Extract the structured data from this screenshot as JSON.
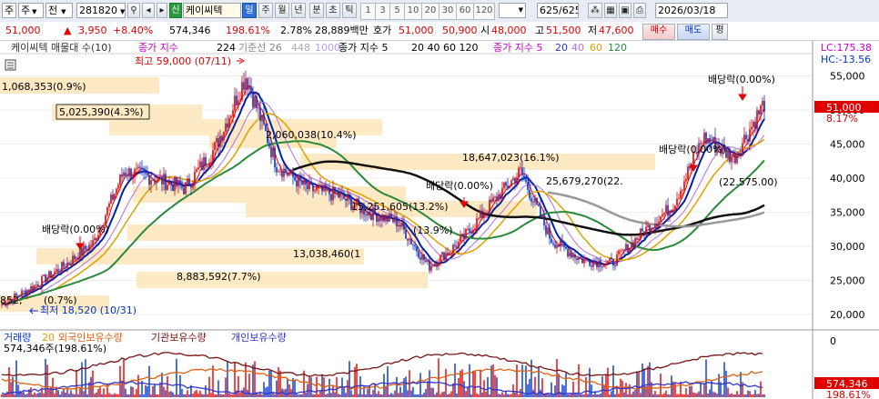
{
  "toolbar": {
    "type_select": "주",
    "price_select": "전",
    "code": "281820",
    "sin_badge": "신",
    "stock_name": "케이씨텍",
    "period_day": "일",
    "period_week": "주",
    "period_month": "월",
    "period_year": "년",
    "period_minute": "분",
    "period_second": "초",
    "period_tick": "틱",
    "intervals": [
      "1",
      "3",
      "5",
      "10",
      "20",
      "30",
      "60",
      "120"
    ],
    "count": "625/625",
    "date": "2026/03/18"
  },
  "quote": {
    "price": "51,000",
    "change_arrow": "▲",
    "change": "3,950",
    "change_pct": "+8.40%",
    "volume": "574,346",
    "volume_pct": "198.61%",
    "turnover": "2.78%",
    "amount": "28,889백만",
    "ask_label": "호가",
    "ask": "51,000",
    "bid": "50,900",
    "open_label": "시",
    "open": "48,000",
    "high_label": "고",
    "high": "51,500",
    "low_label": "저",
    "low": "47,600",
    "buy_button": "매수",
    "sell_button": "매도",
    "eval_button": "평"
  },
  "legend": {
    "main": "케이씨텍 매물대 수(10)",
    "ma_label": "종가 지수",
    "ma_224": "224",
    "ma_base": "기준선 26",
    "ma_448": "448",
    "ma_1000": "1000",
    "ma2_label": "종가 지수 5",
    "ma2_periods": "20  40  60  120",
    "ma3_label": "종가 지수 5",
    "ma3_20": "20",
    "ma3_40": "40",
    "ma3_60": "60",
    "ma3_120": "120"
  },
  "price_axis": {
    "ticks": [
      "55,000",
      "50,000",
      "45,000",
      "40,000",
      "35,000",
      "30,000",
      "25,000",
      "20,000"
    ],
    "lc": "LC:175.38",
    "hc": "HC:-13.56",
    "current_price": "51,000",
    "current_pct": "8.17%"
  },
  "annotations": {
    "high": "최고 59,000 (07/11)",
    "low": "최저 18,520 (10/31)",
    "dividend_1": "배당락(0.00%)",
    "dividend_2": "배당락(0.00%)",
    "dividend_3": "배당락(0.00%)",
    "dividend_4": "배당락(0.00%)",
    "vp_1": "1,068,353(0.9%)",
    "vp_2": "5,025,390(4.3%)",
    "vp_3": "2,060,038(10.4%)",
    "vp_4": "18,647,023(16.1%)",
    "vp_5": "15,251,605(13.2%)",
    "vp_6": "25,679,270(22.",
    "vp_7": "13,038,460(1",
    "vp_8": "(13.9%)",
    "vp_9": "8,883,592(7.7%)",
    "vp_10": "852,",
    "vp_11": "(0.7%)",
    "vp_12": "(22.575.00)"
  },
  "volume_panel": {
    "legend_volume": "거래량",
    "legend_20": "20",
    "legend_foreign": "외국인보유수량",
    "legend_inst": "기관보유수량",
    "legend_indiv": "개인보유수량",
    "current_volume": "574,346주(198.61%)",
    "axis_zero": "0",
    "volume_badge": "574,346",
    "volume_badge_pct": "198.61%"
  },
  "colors": {
    "up": "#e00000",
    "down": "#0033cc",
    "toolbar_bg": "#e9edf3",
    "volume_profile": "#fde9c4"
  },
  "chart_data": {
    "type": "line",
    "series": [
      {
        "name": "종가",
        "x": [
          0,
          4,
          8,
          12,
          16,
          20,
          24,
          28,
          32,
          36,
          40,
          44,
          48,
          52,
          56,
          60,
          64,
          68,
          72,
          76,
          80,
          84,
          88,
          92,
          96,
          100
        ],
        "values": [
          21500,
          24000,
          27000,
          30500,
          41000,
          40000,
          38500,
          44500,
          55000,
          42000,
          38500,
          37500,
          35000,
          33500,
          27000,
          30500,
          36000,
          41000,
          31000,
          28000,
          27500,
          32000,
          36000,
          46000,
          43000,
          51000
        ]
      }
    ],
    "ylim": [
      18000,
      58000
    ],
    "yticks": [
      55000,
      50000,
      45000,
      40000,
      35000,
      30000,
      25000,
      20000
    ]
  }
}
